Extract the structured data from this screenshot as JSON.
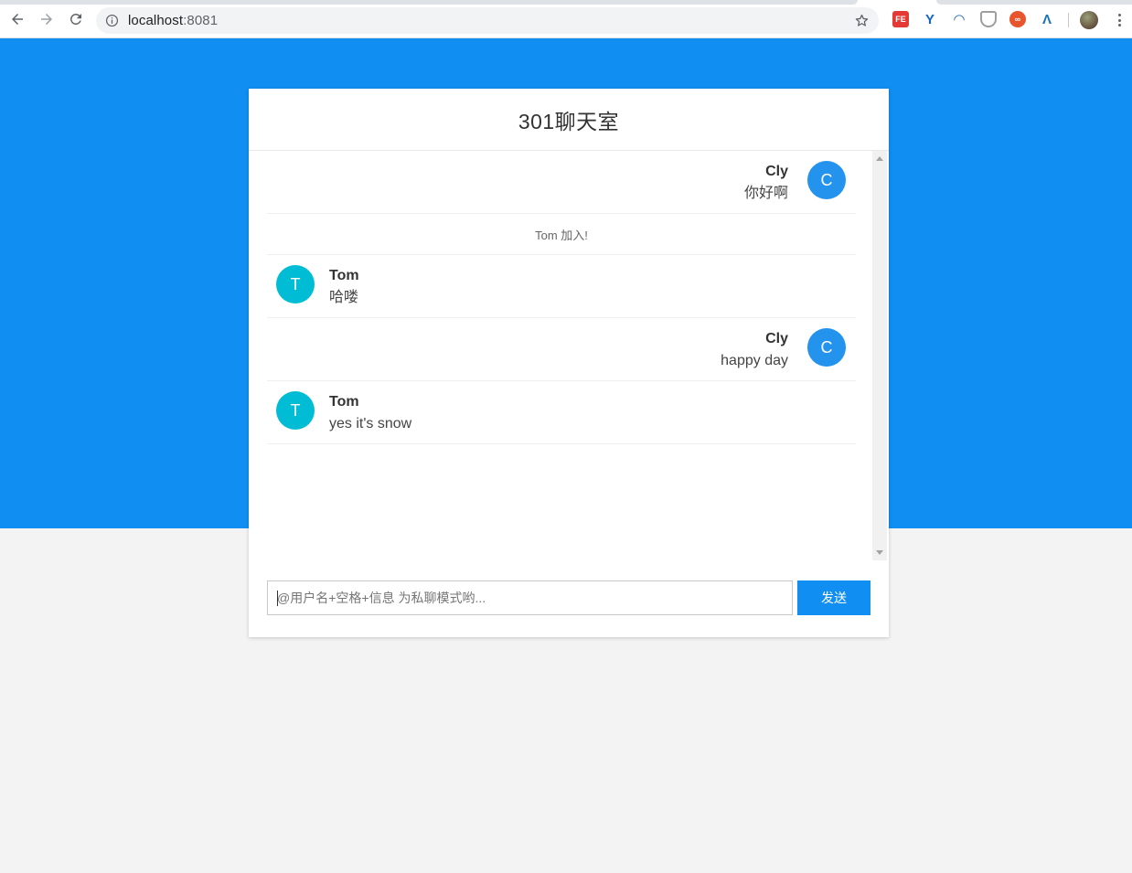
{
  "browser": {
    "url_host": "localhost",
    "url_port": ":8081"
  },
  "extensions": [
    {
      "name": "fe-helper-icon",
      "label": "FE",
      "color": "#e53935"
    },
    {
      "name": "yuque-icon",
      "label": "",
      "color": "#1565c0"
    },
    {
      "name": "swirl-icon",
      "label": "",
      "color": "#1e63b5"
    },
    {
      "name": "shield-icon",
      "label": "",
      "color": "#9e9e9e"
    },
    {
      "name": "infinity-icon",
      "label": "",
      "color": "#e8542c"
    },
    {
      "name": "lambda-icon",
      "label": "",
      "color": "#1a73b8"
    }
  ],
  "colors": {
    "primary": "#108ef2",
    "avatar_self": "#2493ee",
    "avatar_other": "#00bcd4"
  },
  "chat": {
    "title": "301聊天室",
    "messages": [
      {
        "kind": "bubble",
        "side": "right",
        "initial": "C",
        "name": "Cly",
        "text": "你好啊"
      },
      {
        "kind": "system",
        "text": "Tom 加入!"
      },
      {
        "kind": "bubble",
        "side": "left",
        "initial": "T",
        "name": "Tom",
        "text": "哈喽"
      },
      {
        "kind": "bubble",
        "side": "right",
        "initial": "C",
        "name": "Cly",
        "text": "happy day"
      },
      {
        "kind": "bubble",
        "side": "left",
        "initial": "T",
        "name": "Tom",
        "text": "yes it's snow"
      }
    ],
    "input_value": "",
    "input_placeholder": "@用户名+空格+信息 为私聊模式哟...",
    "send_label": "发送"
  }
}
